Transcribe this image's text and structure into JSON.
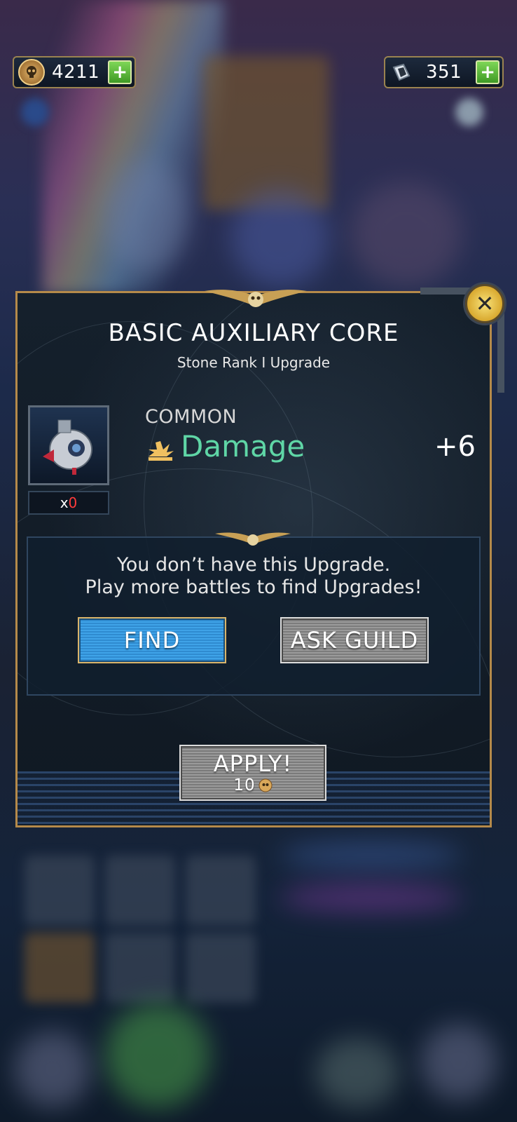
{
  "currencies": {
    "coins": {
      "value": "4211",
      "icon": "skull-coin-icon"
    },
    "gems": {
      "value": "351",
      "icon": "crystal-icon"
    },
    "plus_label": "+"
  },
  "dialog": {
    "title": "BASIC AUXILIARY CORE",
    "subtitle": "Stone Rank I Upgrade",
    "item": {
      "icon": "auxiliary-core-icon",
      "count_prefix": "x",
      "count_value": "0"
    },
    "rarity": "COMMON",
    "stat": {
      "name": "Damage",
      "value": "+6",
      "icon": "damage-burst-icon"
    },
    "message_line1": "You don’t have this Upgrade.",
    "message_line2": "Play more battles to find Upgrades!",
    "find_label": "FIND",
    "ask_guild_label": "ASK GUILD",
    "apply_label": "APPLY!",
    "apply_cost": "10",
    "close_icon": "close-x-icon"
  },
  "colors": {
    "accent_gold": "#b58a4a",
    "stat_green": "#5fd6a6",
    "find_blue": "#3fa3e8",
    "zero_red": "#ff3b3b"
  }
}
